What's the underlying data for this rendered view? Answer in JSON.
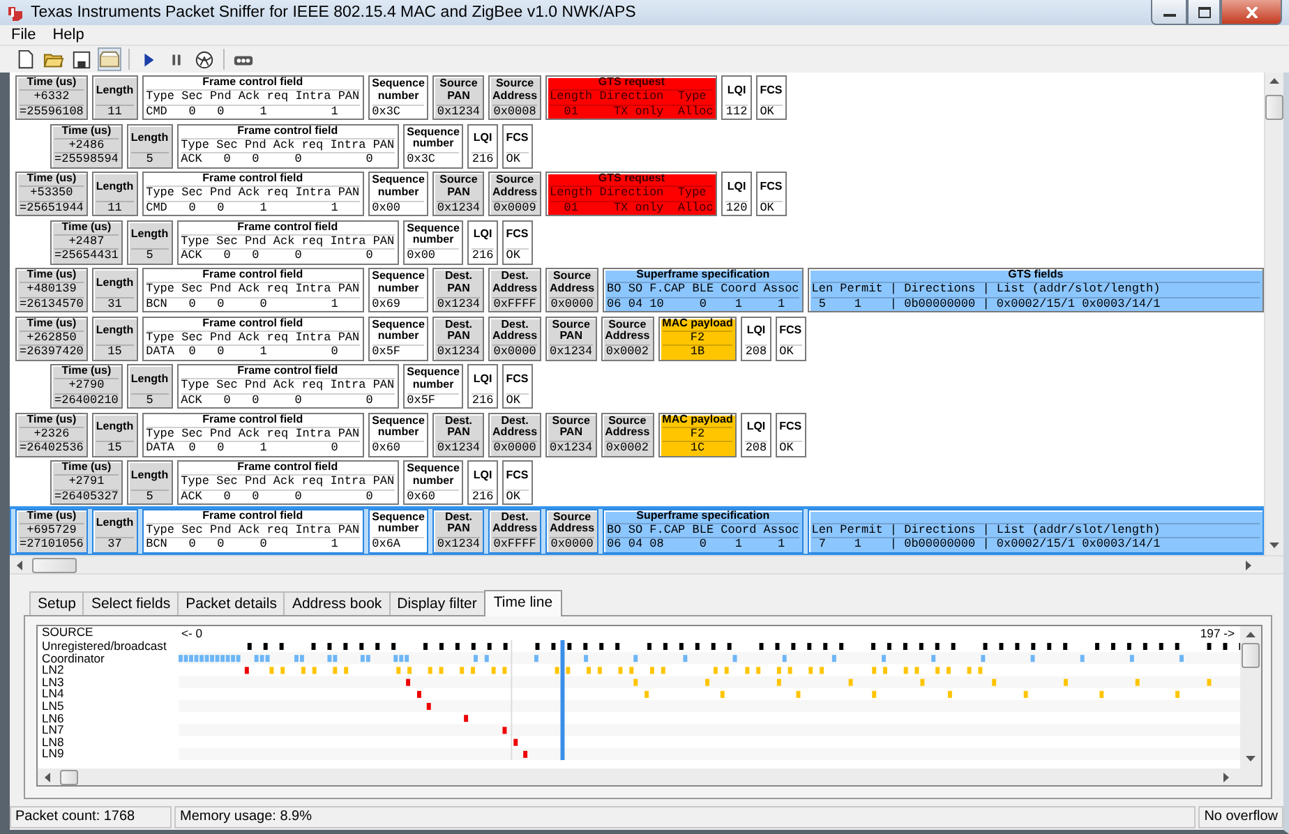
{
  "window": {
    "title": "Texas Instruments Packet Sniffer for IEEE 802.15.4 MAC and ZigBee v1.0 NWK/APS"
  },
  "menu": [
    "File",
    "Help"
  ],
  "toolbar": [
    {
      "kind": "new",
      "pressed": false
    },
    {
      "kind": "open",
      "pressed": false
    },
    {
      "kind": "save",
      "pressed": false
    },
    {
      "kind": "tray",
      "pressed": true
    },
    {
      "kind": "play",
      "pressed": false
    },
    {
      "kind": "pause",
      "pressed": false
    },
    {
      "kind": "sphere",
      "pressed": false
    },
    {
      "kind": "dots",
      "pressed": false
    }
  ],
  "packets": [
    {
      "kind": "frame",
      "selected": false,
      "fields": [
        {
          "kind": "time",
          "title": "Time (us)",
          "rows": [
            "+6332",
            "=25596108"
          ]
        },
        {
          "kind": "meta",
          "title": "Length",
          "rows": [
            "11"
          ]
        },
        {
          "kind": "field",
          "title": "Frame control field",
          "rows": [
            "Type Sec Pnd Ack req Intra PAN",
            "CMD   0   0     1         1"
          ]
        },
        {
          "kind": "field",
          "title": "Sequence number",
          "rows": [
            "0x3C"
          ]
        },
        {
          "kind": "meta",
          "title": "Source PAN",
          "rows": [
            "0x1234"
          ]
        },
        {
          "kind": "meta",
          "title": "Source Address",
          "rows": [
            "0x0008"
          ]
        },
        {
          "kind": "command",
          "title": "GTS request",
          "rows": [
            "Length Direction  Type",
            "  01     TX only  Alloc"
          ]
        },
        {
          "kind": "field",
          "title": "LQI",
          "rows": [
            "112"
          ]
        },
        {
          "kind": "field",
          "title": "FCS",
          "rows": [
            "OK"
          ]
        }
      ]
    },
    {
      "kind": "ack",
      "selected": false,
      "fields": [
        {
          "kind": "time",
          "title": "Time (us)",
          "rows": [
            "+2486",
            "=25598594"
          ]
        },
        {
          "kind": "meta",
          "title": "Length",
          "rows": [
            "5"
          ]
        },
        {
          "kind": "field",
          "title": "Frame control field",
          "rows": [
            "Type Sec Pnd Ack req Intra PAN",
            "ACK   0   0     0         0"
          ]
        },
        {
          "kind": "field",
          "title": "Sequence number",
          "rows": [
            "0x3C"
          ]
        },
        {
          "kind": "field",
          "title": "LQI",
          "rows": [
            "216"
          ]
        },
        {
          "kind": "field",
          "title": "FCS",
          "rows": [
            "OK"
          ]
        }
      ]
    },
    {
      "kind": "frame",
      "selected": false,
      "fields": [
        {
          "kind": "time",
          "title": "Time (us)",
          "rows": [
            "+53350",
            "=25651944"
          ]
        },
        {
          "kind": "meta",
          "title": "Length",
          "rows": [
            "11"
          ]
        },
        {
          "kind": "field",
          "title": "Frame control field",
          "rows": [
            "Type Sec Pnd Ack req Intra PAN",
            "CMD   0   0     1         1"
          ]
        },
        {
          "kind": "field",
          "title": "Sequence number",
          "rows": [
            "0x00"
          ]
        },
        {
          "kind": "meta",
          "title": "Source PAN",
          "rows": [
            "0x1234"
          ]
        },
        {
          "kind": "meta",
          "title": "Source Address",
          "rows": [
            "0x0009"
          ]
        },
        {
          "kind": "command",
          "title": "GTS request",
          "rows": [
            "Length Direction  Type",
            "  01     TX only  Alloc"
          ]
        },
        {
          "kind": "field",
          "title": "LQI",
          "rows": [
            "120"
          ]
        },
        {
          "kind": "field",
          "title": "FCS",
          "rows": [
            "OK"
          ]
        }
      ]
    },
    {
      "kind": "ack",
      "selected": false,
      "fields": [
        {
          "kind": "time",
          "title": "Time (us)",
          "rows": [
            "+2487",
            "=25654431"
          ]
        },
        {
          "kind": "meta",
          "title": "Length",
          "rows": [
            "5"
          ]
        },
        {
          "kind": "field",
          "title": "Frame control field",
          "rows": [
            "Type Sec Pnd Ack req Intra PAN",
            "ACK   0   0     0         0"
          ]
        },
        {
          "kind": "field",
          "title": "Sequence number",
          "rows": [
            "0x00"
          ]
        },
        {
          "kind": "field",
          "title": "LQI",
          "rows": [
            "216"
          ]
        },
        {
          "kind": "field",
          "title": "FCS",
          "rows": [
            "OK"
          ]
        }
      ]
    },
    {
      "kind": "frame",
      "selected": false,
      "fields": [
        {
          "kind": "time",
          "title": "Time (us)",
          "rows": [
            "+480139",
            "=26134570"
          ]
        },
        {
          "kind": "meta",
          "title": "Length",
          "rows": [
            "31"
          ]
        },
        {
          "kind": "field",
          "title": "Frame control field",
          "rows": [
            "Type Sec Pnd Ack req Intra PAN",
            "BCN   0   0     0         1"
          ]
        },
        {
          "kind": "field",
          "title": "Sequence number",
          "rows": [
            "0x69"
          ]
        },
        {
          "kind": "meta",
          "title": "Dest. PAN",
          "rows": [
            "0x1234"
          ]
        },
        {
          "kind": "meta",
          "title": "Dest. Address",
          "rows": [
            "0xFFFF"
          ]
        },
        {
          "kind": "meta",
          "title": "Source Address",
          "rows": [
            "0x0000"
          ]
        },
        {
          "kind": "beacon",
          "title": "Superframe specification",
          "rows": [
            "BO SO F.CAP BLE Coord Assoc",
            "06 04 10     0    1     1"
          ]
        },
        {
          "kind": "beacon",
          "title": "GTS fields",
          "rows": [
            "Len Permit | Directions | List (addr/slot/length)",
            " 5    1    | 0b00000000 | 0x0002/15/1 0x0003/14/1"
          ]
        }
      ]
    },
    {
      "kind": "frame",
      "selected": false,
      "fields": [
        {
          "kind": "time",
          "title": "Time (us)",
          "rows": [
            "+262850",
            "=26397420"
          ]
        },
        {
          "kind": "meta",
          "title": "Length",
          "rows": [
            "15"
          ]
        },
        {
          "kind": "field",
          "title": "Frame control field",
          "rows": [
            "Type Sec Pnd Ack req Intra PAN",
            "DATA  0   0     1         0"
          ]
        },
        {
          "kind": "field",
          "title": "Sequence number",
          "rows": [
            "0x5F"
          ]
        },
        {
          "kind": "meta",
          "title": "Dest. PAN",
          "rows": [
            "0x1234"
          ]
        },
        {
          "kind": "meta",
          "title": "Dest. Address",
          "rows": [
            "0x0000"
          ]
        },
        {
          "kind": "meta",
          "title": "Source PAN",
          "rows": [
            "0x1234"
          ]
        },
        {
          "kind": "meta",
          "title": "Source Address",
          "rows": [
            "0x0002"
          ]
        },
        {
          "kind": "payload",
          "title": "MAC payload",
          "rows": [
            "F2",
            "1B"
          ]
        },
        {
          "kind": "field",
          "title": "LQI",
          "rows": [
            "208"
          ]
        },
        {
          "kind": "field",
          "title": "FCS",
          "rows": [
            "OK"
          ]
        }
      ]
    },
    {
      "kind": "ack",
      "selected": false,
      "fields": [
        {
          "kind": "time",
          "title": "Time (us)",
          "rows": [
            "+2790",
            "=26400210"
          ]
        },
        {
          "kind": "meta",
          "title": "Length",
          "rows": [
            "5"
          ]
        },
        {
          "kind": "field",
          "title": "Frame control field",
          "rows": [
            "Type Sec Pnd Ack req Intra PAN",
            "ACK   0   0     0         0"
          ]
        },
        {
          "kind": "field",
          "title": "Sequence number",
          "rows": [
            "0x5F"
          ]
        },
        {
          "kind": "field",
          "title": "LQI",
          "rows": [
            "216"
          ]
        },
        {
          "kind": "field",
          "title": "FCS",
          "rows": [
            "OK"
          ]
        }
      ]
    },
    {
      "kind": "frame",
      "selected": false,
      "fields": [
        {
          "kind": "time",
          "title": "Time (us)",
          "rows": [
            "+2326",
            "=26402536"
          ]
        },
        {
          "kind": "meta",
          "title": "Length",
          "rows": [
            "15"
          ]
        },
        {
          "kind": "field",
          "title": "Frame control field",
          "rows": [
            "Type Sec Pnd Ack req Intra PAN",
            "DATA  0   0     1         0"
          ]
        },
        {
          "kind": "field",
          "title": "Sequence number",
          "rows": [
            "0x60"
          ]
        },
        {
          "kind": "meta",
          "title": "Dest. PAN",
          "rows": [
            "0x1234"
          ]
        },
        {
          "kind": "meta",
          "title": "Dest. Address",
          "rows": [
            "0x0000"
          ]
        },
        {
          "kind": "meta",
          "title": "Source PAN",
          "rows": [
            "0x1234"
          ]
        },
        {
          "kind": "meta",
          "title": "Source Address",
          "rows": [
            "0x0002"
          ]
        },
        {
          "kind": "payload",
          "title": "MAC payload",
          "rows": [
            "F2",
            "1C"
          ]
        },
        {
          "kind": "field",
          "title": "LQI",
          "rows": [
            "208"
          ]
        },
        {
          "kind": "field",
          "title": "FCS",
          "rows": [
            "OK"
          ]
        }
      ]
    },
    {
      "kind": "ack",
      "selected": false,
      "fields": [
        {
          "kind": "time",
          "title": "Time (us)",
          "rows": [
            "+2791",
            "=26405327"
          ]
        },
        {
          "kind": "meta",
          "title": "Length",
          "rows": [
            "5"
          ]
        },
        {
          "kind": "field",
          "title": "Frame control field",
          "rows": [
            "Type Sec Pnd Ack req Intra PAN",
            "ACK   0   0     0         0"
          ]
        },
        {
          "kind": "field",
          "title": "Sequence number",
          "rows": [
            "0x60"
          ]
        },
        {
          "kind": "field",
          "title": "LQI",
          "rows": [
            "216"
          ]
        },
        {
          "kind": "field",
          "title": "FCS",
          "rows": [
            "OK"
          ]
        }
      ]
    },
    {
      "kind": "frame",
      "selected": true,
      "fields": [
        {
          "kind": "time",
          "title": "Time (us)",
          "rows": [
            "+695729",
            "=27101056"
          ]
        },
        {
          "kind": "meta",
          "title": "Length",
          "rows": [
            "37"
          ]
        },
        {
          "kind": "field",
          "title": "Frame control field",
          "rows": [
            "Type Sec Pnd Ack req Intra PAN",
            "BCN   0   0     0         1"
          ]
        },
        {
          "kind": "field",
          "title": "Sequence number",
          "rows": [
            "0x6A"
          ]
        },
        {
          "kind": "meta",
          "title": "Dest. PAN",
          "rows": [
            "0x1234"
          ]
        },
        {
          "kind": "meta",
          "title": "Dest. Address",
          "rows": [
            "0xFFFF"
          ]
        },
        {
          "kind": "meta",
          "title": "Source Address",
          "rows": [
            "0x0000"
          ]
        },
        {
          "kind": "beacon",
          "title": "Superframe specification",
          "rows": [
            "BO SO F.CAP BLE Coord Assoc",
            "06 04 08     0    1     1"
          ]
        },
        {
          "kind": "beacon",
          "rows": [
            "Len Permit | Directions | List (addr/slot/length)",
            " 7    1    | 0b00000000 | 0x0002/15/1 0x0003/14/1"
          ]
        }
      ]
    }
  ],
  "tabs": [
    {
      "label": "Setup",
      "selected": false
    },
    {
      "label": "Select fields",
      "selected": false
    },
    {
      "label": "Packet details",
      "selected": false
    },
    {
      "label": "Address book",
      "selected": false
    },
    {
      "label": "Display filter",
      "selected": false
    },
    {
      "label": "Time line",
      "selected": true
    }
  ],
  "timeline": {
    "header": "SOURCE",
    "start": "<- 0",
    "end": "197 ->",
    "lanes": [
      "Unregistered/broadcast",
      "Coordinator",
      "LN2",
      "LN3",
      "LN4",
      "LN5",
      "LN6",
      "LN7",
      "LN8",
      "LN9"
    ]
  },
  "status_bar": [
    "Packet count: 1768",
    "Memory usage: 8.9%",
    "No overflow"
  ]
}
